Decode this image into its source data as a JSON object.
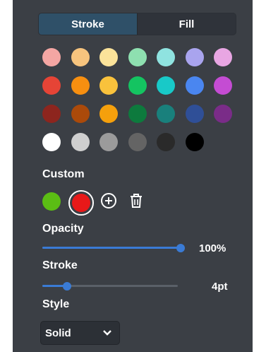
{
  "tabs": [
    {
      "label": "Stroke",
      "active": true
    },
    {
      "label": "Fill",
      "active": false
    }
  ],
  "palette": [
    [
      "#f4a6a3",
      "#f7c47e",
      "#fbe39a",
      "#8ee0b0",
      "#8fe3e0",
      "#a9a4ee",
      "#e8a6e3"
    ],
    [
      "#e64436",
      "#f78f10",
      "#f9c23c",
      "#14c461",
      "#18c9c8",
      "#4a86f0",
      "#c44cd3"
    ],
    [
      "#8d251e",
      "#ab4a0a",
      "#f5a00c",
      "#0d7a3d",
      "#19807c",
      "#2f4f97",
      "#7a2c88"
    ],
    [
      "#ffffff",
      "#cfcfcf",
      "#9b9b9b",
      "#646464",
      "#2a2a2a",
      "#000000"
    ]
  ],
  "custom": {
    "label": "Custom",
    "colors": [
      "#5bbd14",
      "#e81919"
    ],
    "selected": "#e81919"
  },
  "opacity": {
    "label": "Opacity",
    "value_text": "100%",
    "fraction": 1.0
  },
  "stroke": {
    "label": "Stroke",
    "value_text": "4pt",
    "fraction": 0.18
  },
  "style": {
    "label": "Style",
    "selected": "Solid"
  },
  "colors": {
    "accent": "#3a7bd5",
    "panel": "#3b3f45",
    "track": "#5a6068"
  }
}
